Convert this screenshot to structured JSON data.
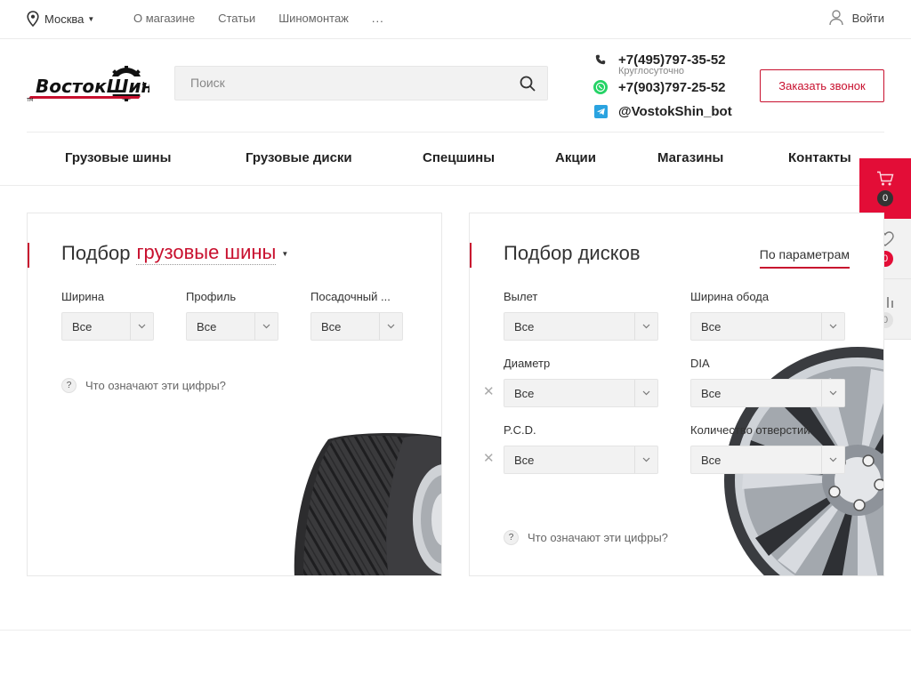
{
  "topbar": {
    "city": "Москва",
    "links": [
      "О магазине",
      "Статьи",
      "Шиномонтаж"
    ],
    "more": "...",
    "login": "Войти"
  },
  "header": {
    "logo_text": "ВостокШин",
    "search_placeholder": "Поиск",
    "phone1": "+7(495)797-35-52",
    "phone1_note": "Круглосуточно",
    "phone2": "+7(903)797-25-52",
    "telegram": "@VostokShin_bot",
    "callback_label": "Заказать звонок"
  },
  "nav": [
    "Грузовые шины",
    "Грузовые диски",
    "Спецшины",
    "Акции",
    "Магазины",
    "Контакты"
  ],
  "side": {
    "cart_count": "0",
    "favorites_count": "0",
    "compare_count": "0"
  },
  "tires": {
    "title": "Подбор",
    "category": "грузовые шины",
    "fields": [
      {
        "label": "Ширина",
        "value": "Все"
      },
      {
        "label": "Профиль",
        "value": "Все"
      },
      {
        "label": "Посадочный ...",
        "value": "Все"
      }
    ],
    "help": "Что означают эти цифры?"
  },
  "wheels": {
    "title": "Подбор дисков",
    "tab": "По параметрам",
    "fields": [
      {
        "label": "Вылет",
        "value": "Все"
      },
      {
        "label": "Ширина обода",
        "value": "Все"
      },
      {
        "label": "Диаметр",
        "value": "Все"
      },
      {
        "label": "DIA",
        "value": "Все"
      },
      {
        "label": "P.C.D.",
        "value": "Все"
      },
      {
        "label": "Количество отверстий",
        "value": "Все"
      }
    ],
    "help": "Что означают эти цифры?"
  },
  "colors": {
    "accent": "#c8102e",
    "side_red": "#e30d37"
  }
}
